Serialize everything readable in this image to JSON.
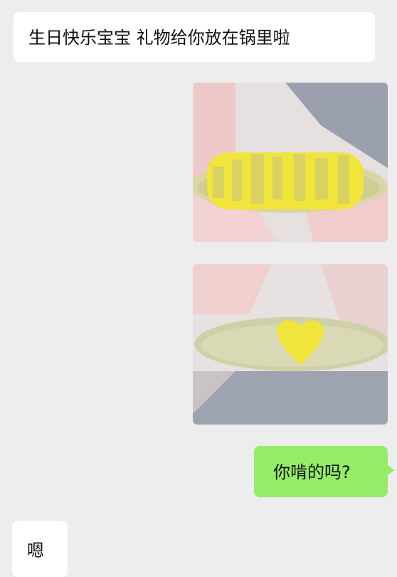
{
  "messages": [
    {
      "side": "incoming",
      "type": "text",
      "text": "生日快乐宝宝 礼物给你放在锅里啦"
    },
    {
      "side": "outgoing",
      "type": "image",
      "icon": "corn-with-birthday-text"
    },
    {
      "side": "outgoing",
      "type": "image",
      "icon": "corn-with-heart"
    },
    {
      "side": "outgoing",
      "type": "text",
      "text": "你啃的吗?"
    },
    {
      "side": "incoming",
      "type": "text",
      "text": "嗯"
    }
  ],
  "colors": {
    "background": "#ededed",
    "incoming_bubble": "#ffffff",
    "outgoing_bubble": "#95ec69",
    "corn_yellow": "#f1e43a",
    "corn_pale": "#d8d8a8"
  }
}
